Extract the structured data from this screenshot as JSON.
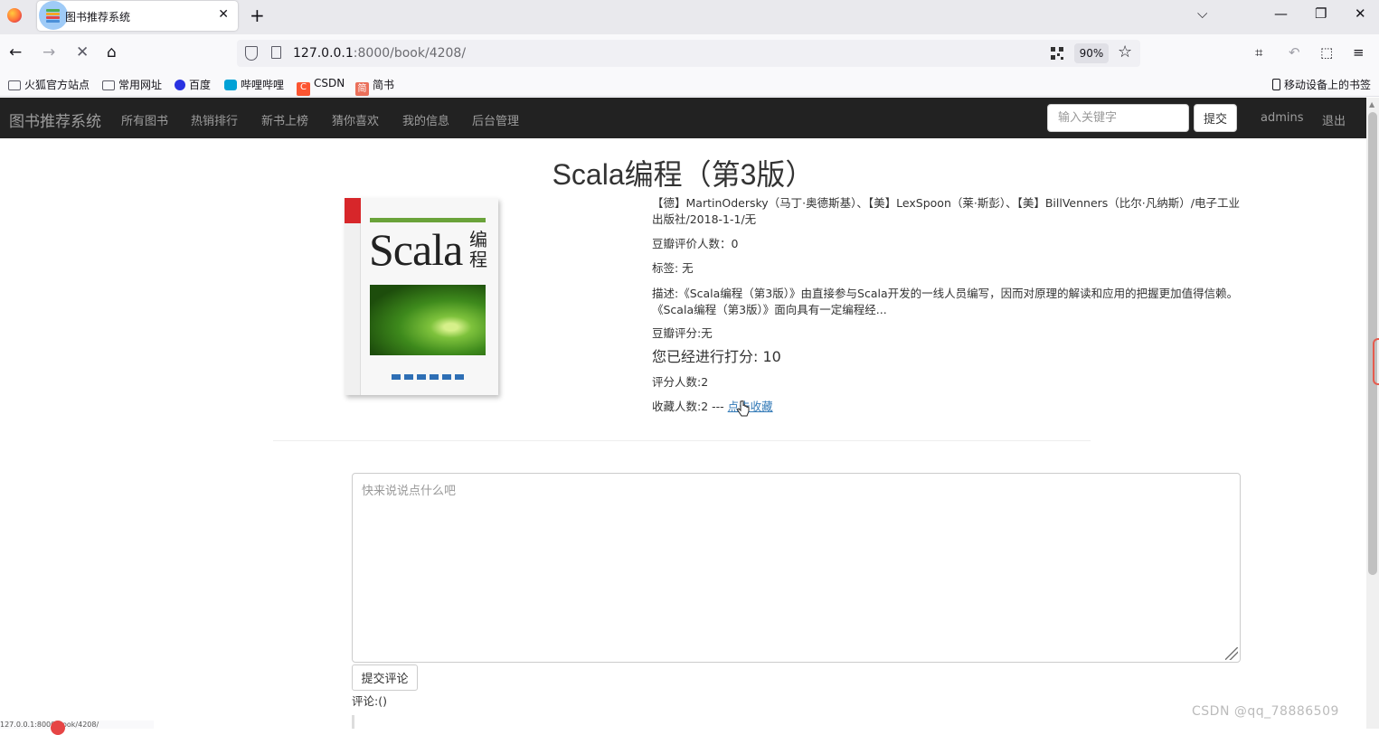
{
  "browser": {
    "tab_title": "图书推荐系统",
    "url_host": "127.0.0.1",
    "url_rest": ":8000/book/4208/",
    "zoom": "90%",
    "bookmarks": [
      "火狐官方站点",
      "常用网址",
      "百度",
      "哔哩哔哩",
      "CSDN",
      "简书"
    ],
    "mobile_bookmarks": "移动设备上的书签",
    "status_url": "127.0.0.1:8000/book/4208/"
  },
  "site": {
    "brand": "图书推荐系统",
    "nav": [
      "所有图书",
      "热销排行",
      "新书上榜",
      "猜你喜欢",
      "我的信息",
      "后台管理"
    ],
    "search_placeholder": "输入关键字",
    "search_button": "提交",
    "username": "admins",
    "logout": "退出"
  },
  "book": {
    "title": "Scala编程（第3版）",
    "cover": {
      "title_en": "Scala",
      "title_cn": "编程"
    },
    "authors_line1": "【德】MartinOdersky（马丁·奥德斯基）、【美】LexSpoon（莱·斯彭）、【美】BillVenners（比尔·凡纳斯）/电子工业",
    "authors_line2": "出版社/2018-1-1/无",
    "douban_raters": "豆瓣评价人数：0",
    "tags": "标签: 无",
    "desc_line1": "描述:《Scala编程（第3版）》由直接参与Scala开发的一线人员编写，因而对原理的解读和应用的把握更加值得信赖。",
    "desc_line2": "《Scala编程（第3版）》面向具有一定编程经...",
    "douban_score": "豆瓣评分:无",
    "your_rating": "您已经进行打分: 10",
    "rater_count": "评分人数:2",
    "collect_count": "收藏人数:2 --- ",
    "collect_link": "点击收藏"
  },
  "comments": {
    "placeholder": "快来说说点什么吧",
    "submit": "提交评论",
    "count_label": "评论:()"
  },
  "watermark": "CSDN @qq_78886509"
}
